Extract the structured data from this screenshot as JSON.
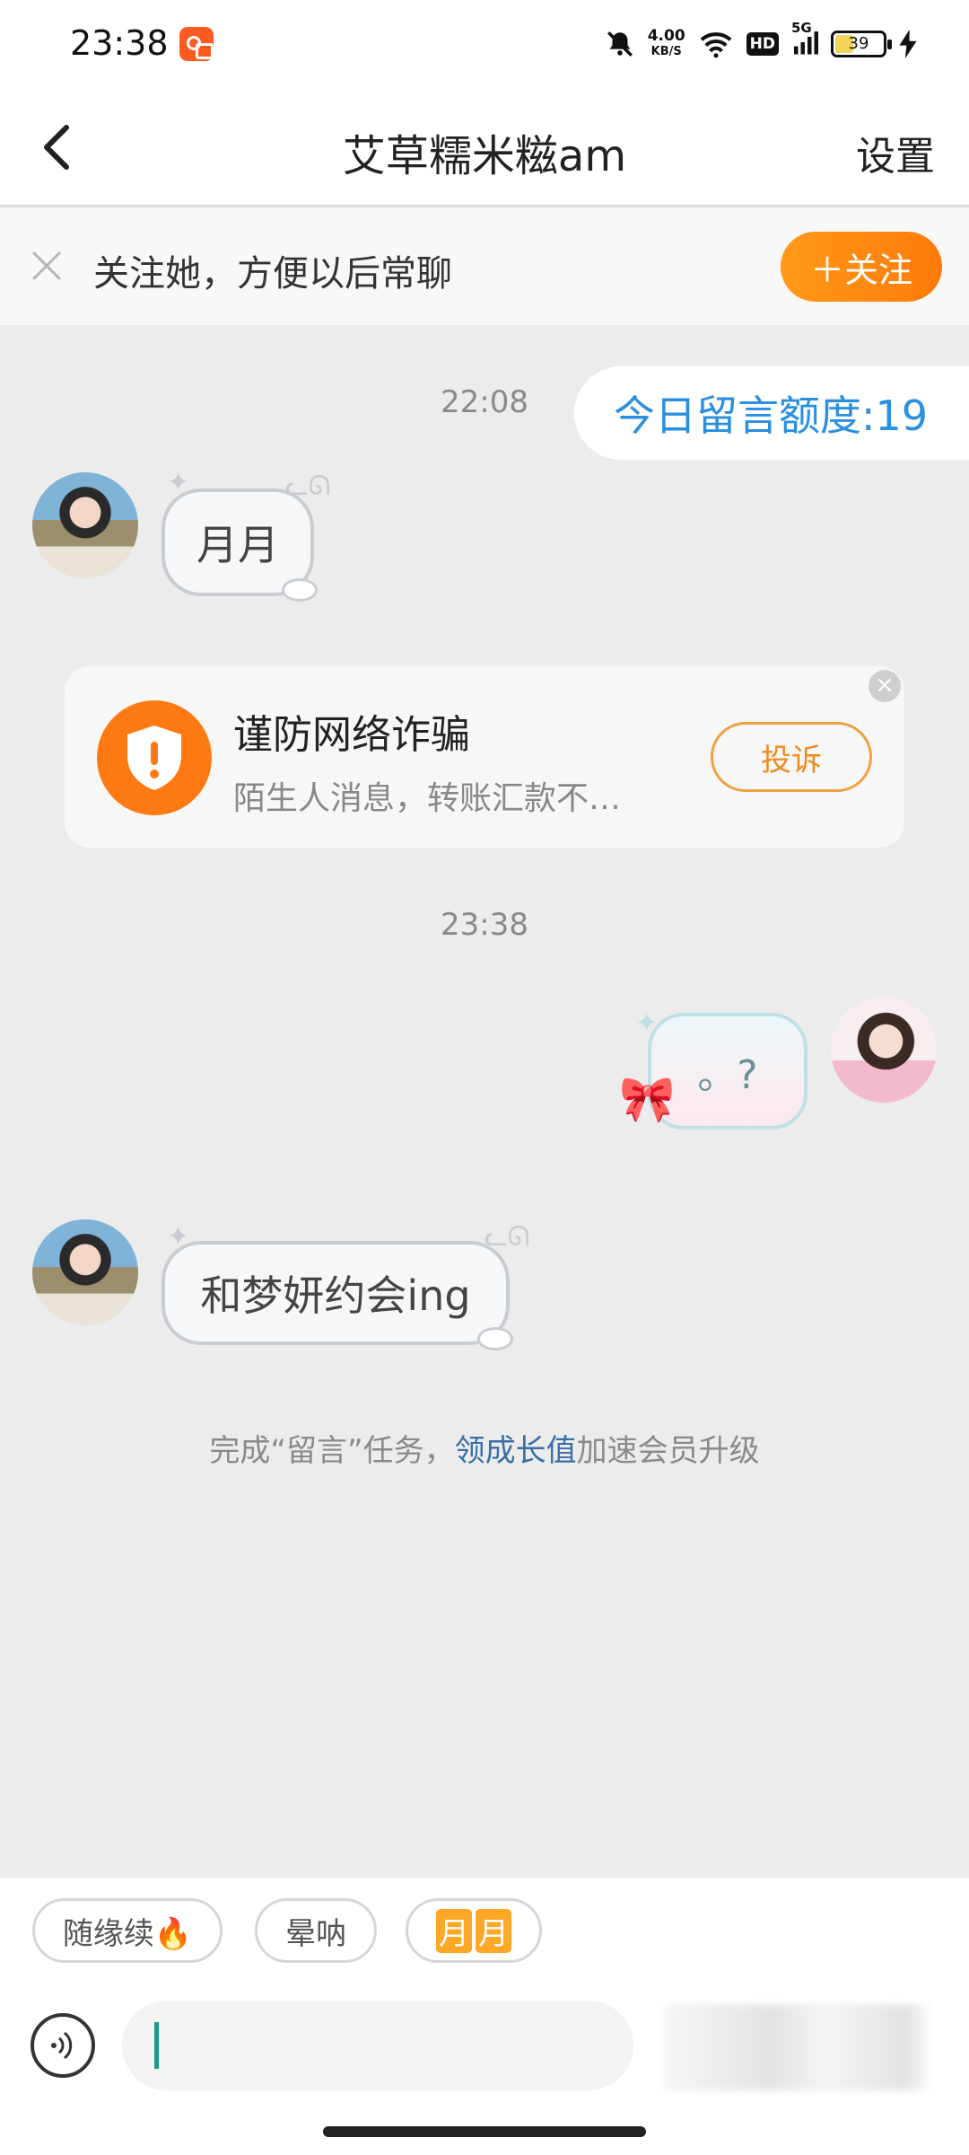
{
  "status_bar": {
    "time": "23:38",
    "net_speed_value": "4.00",
    "net_speed_unit": "KB/S",
    "hd": "HD",
    "network": "5G",
    "battery": "39",
    "battery_level": 0.39,
    "icons": [
      "app-badge-icon",
      "mute-bell-icon",
      "wifi-icon",
      "signal-icon",
      "charging-icon"
    ]
  },
  "header": {
    "title": "艾草糯米糍am",
    "settings_label": "设置"
  },
  "follow_banner": {
    "text": "关注她，方便以后常聊",
    "button_label": "＋关注"
  },
  "chat": {
    "timestamp_1": "22:08",
    "quota_label": "今日留言额度:19",
    "msg_1": "月月",
    "fraud_card": {
      "title": "谨防网络诈骗",
      "description": "陌生人消息，转账汇款不…",
      "button_label": "投诉"
    },
    "timestamp_2": "23:38",
    "msg_2": "。?",
    "msg_3": "和梦妍约会ing",
    "task_prefix": "完成“留言”任务，",
    "task_link": "领成长值",
    "task_suffix": "加速会员升级"
  },
  "quick_replies": {
    "chip_1": "随缘续🔥",
    "chip_2": "晕呐",
    "chip_3_a": "月",
    "chip_3_b": "月"
  },
  "input": {
    "value": ""
  },
  "colors": {
    "accent_orange": "#ff7a0a",
    "link_blue": "#3a6ea5",
    "quota_blue": "#2b8fe0"
  }
}
